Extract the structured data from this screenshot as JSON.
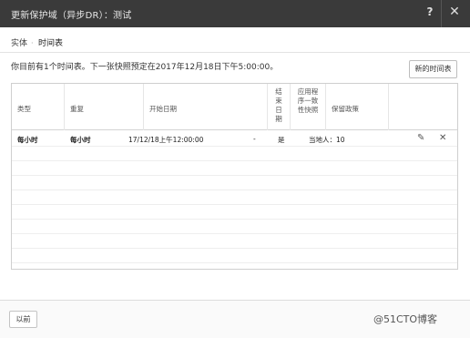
{
  "dialog": {
    "title": "更新保护域（异步DR）：测试",
    "help_label": "?",
    "close_label": "✕"
  },
  "tabs": [
    {
      "label": "实体"
    },
    {
      "label": "时间表"
    }
  ],
  "tab_separator": "·",
  "info": "你目前有1个时间表。下一张快照预定在2017年12月18日下午5:00:00。",
  "new_schedule_label": "新的时间表",
  "table": {
    "headers": {
      "type": "类型",
      "repeat": "重复",
      "start_date": "开始日期",
      "end_date": [
        "结",
        "束",
        "日",
        "期"
      ],
      "app_consistent": [
        "应用程",
        "序一致",
        "性快照"
      ],
      "retention": "保留政策"
    },
    "rows": [
      {
        "type": "每小时",
        "repeat": "每小时",
        "start_date": "17/12/18上午12:00:00",
        "end_date": "-",
        "app_consistent": "是",
        "retention": "当地人：10"
      }
    ]
  },
  "icons": {
    "edit": "✎",
    "delete": "✕"
  },
  "footer": {
    "prev_label": "以前",
    "watermark": "@51CTO博客"
  }
}
